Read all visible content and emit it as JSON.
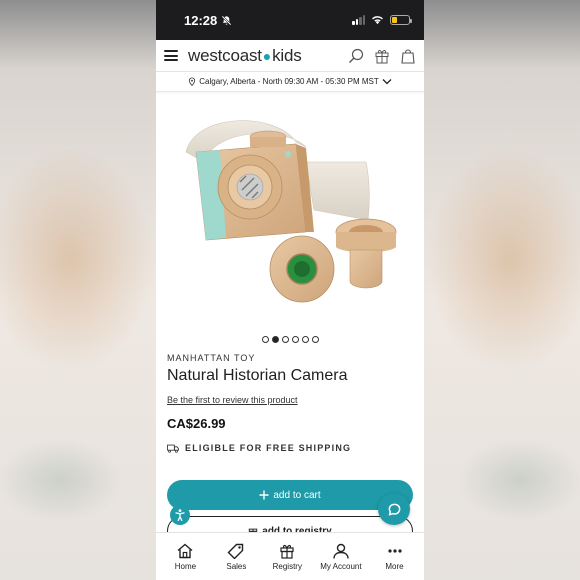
{
  "status_bar": {
    "time": "12:28",
    "battery_level": 0.3
  },
  "header": {
    "logo_part1": "westcoast",
    "logo_part2": "kids",
    "icons": [
      "menu-icon",
      "search-icon",
      "gift-icon",
      "bag-icon"
    ]
  },
  "location": {
    "text": "Calgary, Alberta - North 09:30 AM - 05:30 PM MST"
  },
  "carousel": {
    "count": 6,
    "active_index": 1
  },
  "product": {
    "brand": "MANHATTAN TOY",
    "title": "Natural Historian Camera",
    "review_link": "Be the first to review this product",
    "price": "CA$26.99",
    "shipping": "ELIGIBLE FOR FREE SHIPPING"
  },
  "actions": {
    "add_to_cart": "add to cart",
    "add_to_registry": "add to registry"
  },
  "bottom_nav": [
    {
      "label": "Home",
      "icon": "home-icon"
    },
    {
      "label": "Sales",
      "icon": "tag-icon"
    },
    {
      "label": "Registry",
      "icon": "gift-icon"
    },
    {
      "label": "My Account",
      "icon": "user-icon"
    },
    {
      "label": "More",
      "icon": "more-icon"
    }
  ],
  "colors": {
    "accent": "#1e9aa8",
    "status_bar": "#1c1c1e",
    "background": "#ffffff"
  }
}
